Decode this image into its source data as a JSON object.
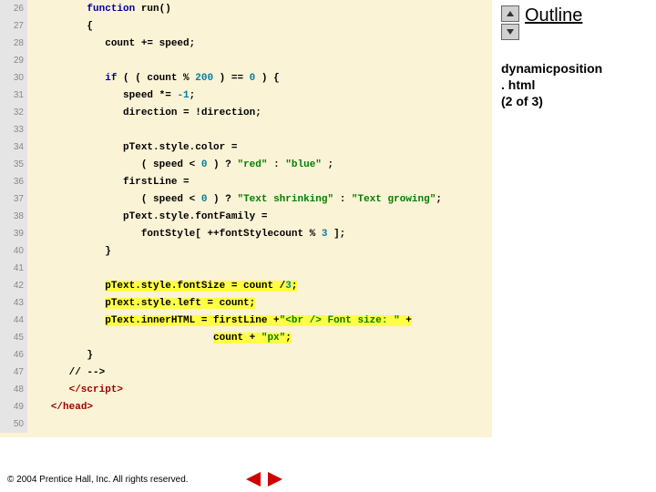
{
  "sidebar": {
    "outline_label": "Outline",
    "file_line1": "dynamicposition",
    "file_line2": ". html",
    "file_line3": "(2 of 3)"
  },
  "footer": {
    "copyright": "© 2004 Prentice Hall, Inc.  All rights reserved."
  },
  "code": {
    "lines": [
      {
        "n": "26",
        "indent": "         ",
        "segs": [
          {
            "t": "function",
            "c": "kw"
          },
          {
            "t": " run()"
          }
        ]
      },
      {
        "n": "27",
        "indent": "         ",
        "segs": [
          {
            "t": "{"
          }
        ]
      },
      {
        "n": "28",
        "indent": "            ",
        "segs": [
          {
            "t": "count += speed;"
          }
        ]
      },
      {
        "n": "29",
        "indent": "",
        "segs": []
      },
      {
        "n": "30",
        "indent": "            ",
        "segs": [
          {
            "t": "if",
            "c": "kw"
          },
          {
            "t": " ( ( count % "
          },
          {
            "t": "200",
            "c": "num"
          },
          {
            "t": " ) == "
          },
          {
            "t": "0",
            "c": "num"
          },
          {
            "t": " ) {"
          }
        ]
      },
      {
        "n": "31",
        "indent": "               ",
        "segs": [
          {
            "t": "speed *= "
          },
          {
            "t": "-1",
            "c": "num"
          },
          {
            "t": ";"
          }
        ]
      },
      {
        "n": "32",
        "indent": "               ",
        "segs": [
          {
            "t": "direction = !direction;"
          }
        ]
      },
      {
        "n": "33",
        "indent": "",
        "segs": []
      },
      {
        "n": "34",
        "indent": "               ",
        "segs": [
          {
            "t": "pText.style.color ="
          }
        ]
      },
      {
        "n": "35",
        "indent": "                  ",
        "segs": [
          {
            "t": "( speed < "
          },
          {
            "t": "0",
            "c": "num"
          },
          {
            "t": " ) ? "
          },
          {
            "t": "\"red\"",
            "c": "str"
          },
          {
            "t": " : "
          },
          {
            "t": "\"blue\"",
            "c": "str"
          },
          {
            "t": " ;"
          }
        ]
      },
      {
        "n": "36",
        "indent": "               ",
        "segs": [
          {
            "t": "firstLine ="
          }
        ]
      },
      {
        "n": "37",
        "indent": "                  ",
        "segs": [
          {
            "t": "( speed < "
          },
          {
            "t": "0",
            "c": "num"
          },
          {
            "t": " ) ? "
          },
          {
            "t": "\"Text shrinking\"",
            "c": "str"
          },
          {
            "t": " : "
          },
          {
            "t": "\"Text growing\"",
            "c": "str"
          },
          {
            "t": ";"
          }
        ]
      },
      {
        "n": "38",
        "indent": "               ",
        "segs": [
          {
            "t": "pText.style.fontFamily ="
          }
        ]
      },
      {
        "n": "39",
        "indent": "                  ",
        "segs": [
          {
            "t": "fontStyle[ ++fontStylecount % "
          },
          {
            "t": "3",
            "c": "num"
          },
          {
            "t": " ];"
          }
        ]
      },
      {
        "n": "40",
        "indent": "            ",
        "segs": [
          {
            "t": "}"
          }
        ]
      },
      {
        "n": "41",
        "indent": "",
        "segs": []
      },
      {
        "n": "42",
        "indent": "            ",
        "segs": [
          {
            "t": "pText.style.fontSize = count /",
            "hl": true
          },
          {
            "t": "3",
            "c": "num",
            "hl": true
          },
          {
            "t": ";",
            "hl": true
          }
        ]
      },
      {
        "n": "43",
        "indent": "            ",
        "segs": [
          {
            "t": "pText.style.left = count;",
            "hl": true
          }
        ]
      },
      {
        "n": "44",
        "indent": "            ",
        "segs": [
          {
            "t": "pText.innerHTML = firstLine +",
            "hl": true
          },
          {
            "t": "\"<br /> Font size: \"",
            "c": "str",
            "hl": true
          },
          {
            "t": " +",
            "hl": true
          }
        ]
      },
      {
        "n": "45",
        "indent": "                              ",
        "segs": [
          {
            "t": "count + ",
            "hl": true
          },
          {
            "t": "\"px\"",
            "c": "str",
            "hl": true
          },
          {
            "t": ";",
            "hl": true
          }
        ]
      },
      {
        "n": "46",
        "indent": "         ",
        "segs": [
          {
            "t": "}"
          }
        ]
      },
      {
        "n": "47",
        "indent": "      ",
        "segs": [
          {
            "t": "// -->"
          }
        ]
      },
      {
        "n": "48",
        "indent": "      ",
        "segs": [
          {
            "t": "</script",
            "c": "tag"
          },
          {
            "t": ">",
            "c": "tag"
          }
        ]
      },
      {
        "n": "49",
        "indent": "   ",
        "segs": [
          {
            "t": "</head>",
            "c": "tag"
          }
        ]
      },
      {
        "n": "50",
        "indent": "",
        "segs": []
      }
    ]
  }
}
